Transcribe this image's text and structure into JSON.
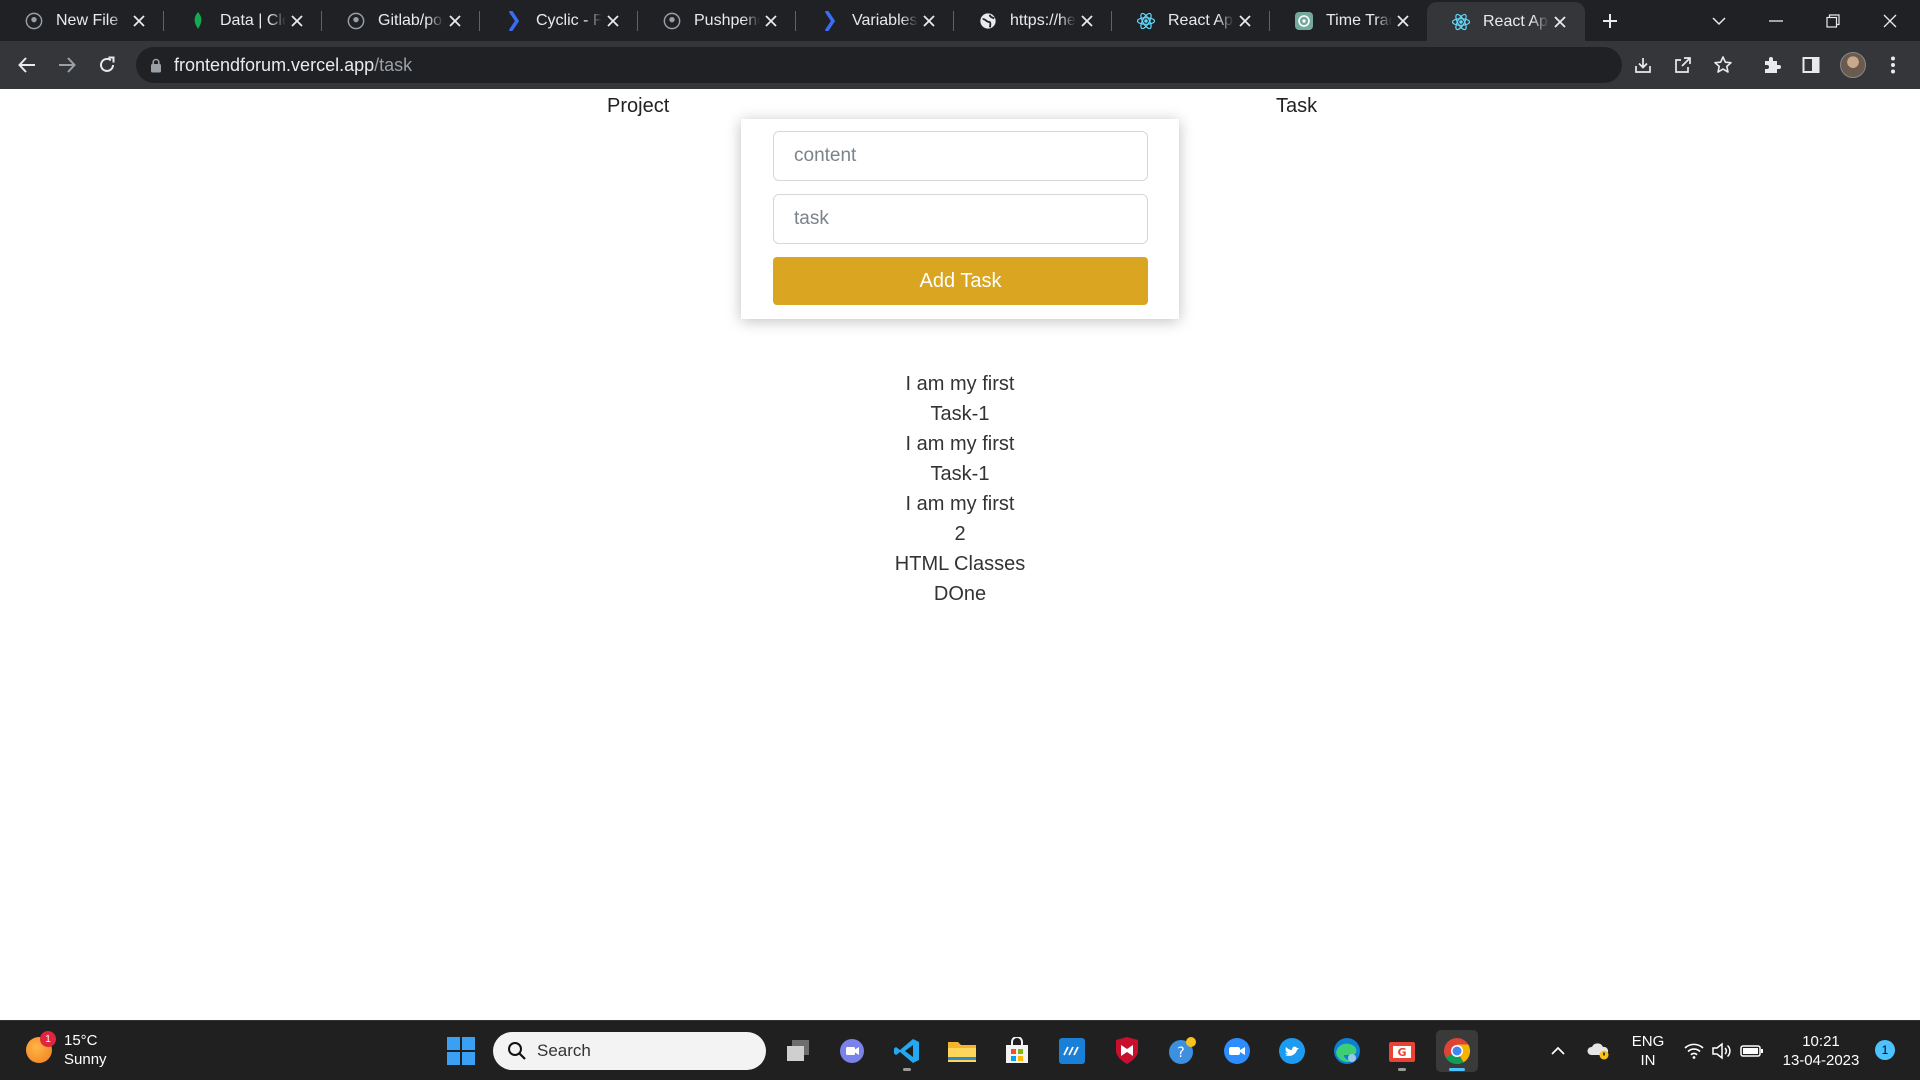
{
  "browser": {
    "tabs": [
      {
        "title": "New File",
        "icon": "github-icon"
      },
      {
        "title": "Data | Cloud",
        "icon": "mongodb-leaf-icon"
      },
      {
        "title": "Gitlab/postman",
        "icon": "github-icon"
      },
      {
        "title": "Cyclic - Full",
        "icon": "cyclic-icon"
      },
      {
        "title": "Pushpendra",
        "icon": "github-icon"
      },
      {
        "title": "Variables - p",
        "icon": "cyclic-icon"
      },
      {
        "title": "https://help",
        "icon": "globe-icon"
      },
      {
        "title": "React App",
        "icon": "react-icon"
      },
      {
        "title": "Time Tracking",
        "icon": "chatgpt-icon"
      },
      {
        "title": "React App",
        "icon": "react-icon",
        "active": true
      }
    ],
    "address_bar": {
      "domain": "frontendforum.vercel.app",
      "path": "/task"
    }
  },
  "page": {
    "nav": {
      "project_label": "Project",
      "task_label": "Task"
    },
    "form": {
      "content_placeholder": "content",
      "task_placeholder": "task",
      "submit_label": "Add Task",
      "button_color": "#daa520"
    },
    "task_lines": [
      "I am my first",
      "Task-1",
      "I am my first",
      "Task-1",
      "I am my first",
      "2",
      "HTML Classes",
      "DOne"
    ]
  },
  "taskbar": {
    "weather": {
      "temp": "15°C",
      "condition": "Sunny",
      "badge": "1"
    },
    "search_placeholder": "Search",
    "language": {
      "line1": "ENG",
      "line2": "IN"
    },
    "clock": {
      "time": "10:21",
      "date": "13-04-2023"
    },
    "notification_count": "1"
  },
  "colors": {
    "tabstrip": "#202124",
    "toolbar": "#35363a",
    "accent_button": "#daa520",
    "taskbar": "#202020"
  }
}
